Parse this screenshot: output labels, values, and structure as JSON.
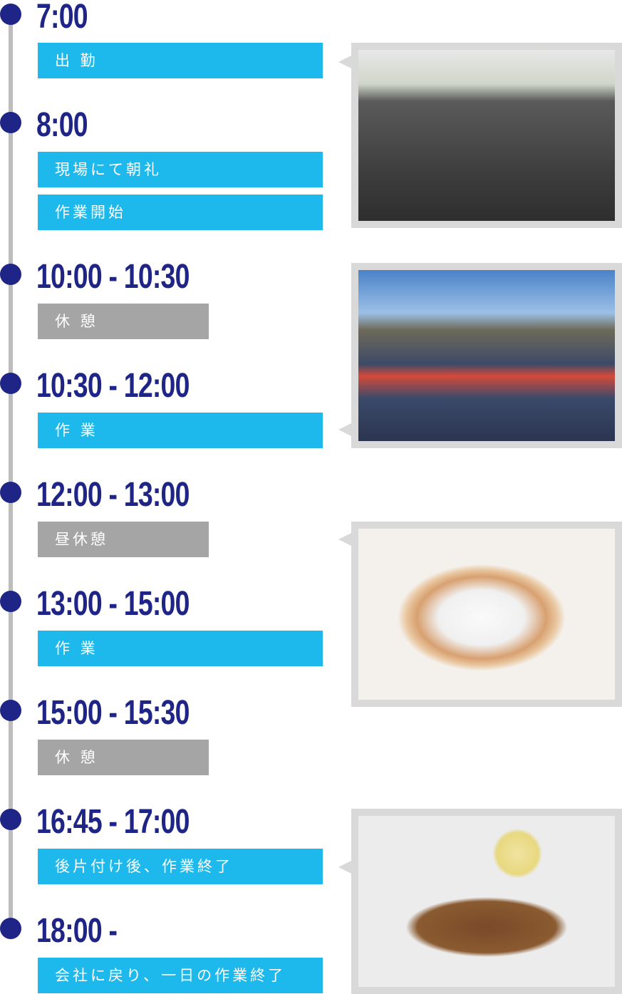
{
  "colors": {
    "accent": "#1eb9ec",
    "break": "#a5a5a5",
    "time": "#1f2587",
    "timeline": "#bdbdbd",
    "frame": "#d9d9d9"
  },
  "schedule": [
    {
      "time": "7:00",
      "items": [
        {
          "label": "出 勤",
          "type": "work"
        }
      ]
    },
    {
      "time": "8:00",
      "items": [
        {
          "label": "現場にて朝礼",
          "type": "work"
        },
        {
          "label": "作業開始",
          "type": "work"
        }
      ]
    },
    {
      "time": "10:00 - 10:30",
      "items": [
        {
          "label": "休 憩",
          "type": "break"
        }
      ]
    },
    {
      "time": "10:30 - 12:00",
      "items": [
        {
          "label": "作 業",
          "type": "work"
        }
      ]
    },
    {
      "time": "12:00 - 13:00",
      "items": [
        {
          "label": "昼休憩",
          "type": "break"
        }
      ]
    },
    {
      "time": "13:00 - 15:00",
      "items": [
        {
          "label": "作 業",
          "type": "work"
        }
      ]
    },
    {
      "time": "15:00 - 15:30",
      "items": [
        {
          "label": "休 憩",
          "type": "break"
        }
      ]
    },
    {
      "time": "16:45 - 17:00",
      "items": [
        {
          "label": "後片付け後、作業終了",
          "type": "work"
        }
      ]
    },
    {
      "time": "18:00 -",
      "items": [
        {
          "label": "会社に戻り、一日の作業終了",
          "type": "work"
        }
      ]
    }
  ],
  "photos": [
    "van-interior-photo",
    "roof-work-photo",
    "bento-lunch-photo",
    "tool-belt-helmet-photo"
  ]
}
